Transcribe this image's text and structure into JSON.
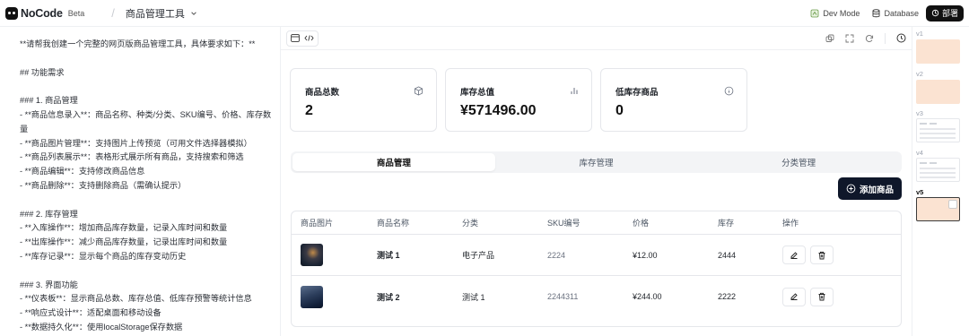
{
  "app": {
    "name": "NoCode",
    "badge": "Beta",
    "project": "商品管理工具"
  },
  "topbar": {
    "dev_mode": "Dev Mode",
    "database": "Database",
    "deploy": "部署"
  },
  "chat": {
    "lines": [
      "**请帮我创建一个完整的网页版商品管理工具，具体要求如下：**",
      "",
      "## 功能需求",
      "",
      "### 1. 商品管理",
      "- **商品信息录入**：商品名称、种类/分类、SKU编号、价格、库存数",
      "量",
      "- **商品图片管理**：支持图片上传预览（可用文件选择器模拟）",
      "- **商品列表展示**：表格形式展示所有商品，支持搜索和筛选",
      "- **商品编辑**：支持修改商品信息",
      "- **商品删除**：支持删除商品（需确认提示）",
      "",
      "### 2. 库存管理",
      "- **入库操作**：增加商品库存数量，记录入库时间和数量",
      "- **出库操作**：减少商品库存数量，记录出库时间和数量",
      "- **库存记录**：显示每个商品的库存变动历史",
      "",
      "### 3. 界面功能",
      "- **仪表板**：显示商品总数、库存总值、低库存预警等统计信息",
      "- **响应式设计**：适配桌面和移动设备",
      "- **数据持久化**：使用localStorage保存数据"
    ]
  },
  "stats": [
    {
      "label": "商品总数",
      "value": "2",
      "icon": "box-icon"
    },
    {
      "label": "库存总值",
      "value": "¥571496.00",
      "icon": "bar-chart-icon"
    },
    {
      "label": "低库存商品",
      "value": "0",
      "icon": "info-icon"
    }
  ],
  "tabs": [
    {
      "label": "商品管理",
      "active": true
    },
    {
      "label": "库存管理",
      "active": false
    },
    {
      "label": "分类管理",
      "active": false
    }
  ],
  "add_button": "添加商品",
  "table": {
    "headers": [
      "商品图片",
      "商品名称",
      "分类",
      "SKU编号",
      "价格",
      "库存",
      "操作"
    ],
    "rows": [
      {
        "name": "测试 1",
        "category": "电子产品",
        "sku": "2224",
        "price": "¥12.00",
        "stock": "2444"
      },
      {
        "name": "测试 2",
        "category": "测试 1",
        "sku": "2244311",
        "price": "¥244.00",
        "stock": "2222"
      }
    ]
  },
  "versions": [
    {
      "label": "v1"
    },
    {
      "label": "v2"
    },
    {
      "label": "v3"
    },
    {
      "label": "v4"
    },
    {
      "label": "v5",
      "current": true
    }
  ],
  "colors": {
    "accent": "#0f172a",
    "peach": "#fbe3d2",
    "border": "#e5e7eb"
  }
}
